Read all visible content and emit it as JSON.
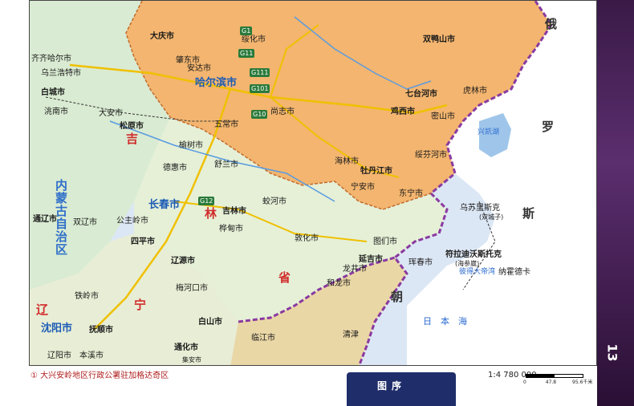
{
  "page_number": "13",
  "footnote": "① 大兴安岭地区行政公署驻加格达奇区",
  "tab_label": "图序",
  "scale": {
    "ratio": "1:4 780 000",
    "ticks": [
      "0",
      "47.8",
      "95.6千米"
    ]
  },
  "countries": {
    "russia_1": "俄",
    "russia_2": "罗",
    "russia_3": "斯"
  },
  "provinces": {
    "jilin_1": "吉",
    "jilin_2": "林",
    "jilin_3": "省",
    "liaoning_1": "辽",
    "liaoning_2": "宁",
    "inner_mongolia": "内蒙古自治区",
    "korea": "朝"
  },
  "waters": {
    "sea_of_japan": "日　本　海",
    "peter_bay": "彼得大帝湾",
    "khanka": "兴凯湖"
  },
  "cities": {
    "harbin": "哈尔滨市",
    "daqing": "大庆市",
    "qiqihar_area": "齐齐哈尔市",
    "jixi": "鸡西市",
    "qitaihe": "七台河市",
    "mudanjiang": "牡丹江市",
    "changchun": "长春市",
    "jilin": "吉林市",
    "siping": "四平市",
    "liaoyuan": "辽源市",
    "tieling": "铁岭市",
    "shenyang": "沈阳市",
    "fushun": "抚顺市",
    "tonghua": "通化市",
    "baishan": "白山市",
    "yanji": "延吉市",
    "tumen": "图们市",
    "songyuan": "松原市",
    "baicheng": "白城市",
    "tongliao": "通辽市",
    "ulanhot": "乌兰浩特市",
    "zhaodong": "肇东市",
    "suihua": "绥化市",
    "shuangyashan": "双鸭山市",
    "hunchun": "珲春市",
    "dunhua": "敦化市",
    "vladivostok": "符拉迪沃斯托克",
    "vladivostok_sub": "(海参崴)",
    "ussuriysk": "乌苏里斯克",
    "ussuriysk_sub": "(双城子)",
    "qingjin": "清津",
    "nakhodka": "纳霍德卡",
    "liaoyang": "辽阳市",
    "benxi": "本溪市",
    "mishan": "密山市",
    "hulin": "虎林市",
    "dongning": "东宁市",
    "suifenhe": "绥芬河市",
    "ningan": "宁安市",
    "hailin": "海林市",
    "shangzhi": "尚志市",
    "wuchang": "五常市",
    "shulan": "舒兰市",
    "jiaohe": "蛟河市",
    "huadian": "桦甸市",
    "meihekou": "梅河口市",
    "ji_an": "集安市",
    "linjiang": "临江市",
    "helong": "和龙市",
    "longjing": "龙井市",
    "yushu": "榆树市",
    "dehui": "德惠市",
    "gongzhuling": "公主岭市",
    "shuangliao": "双辽市",
    "taonan": "洮南市",
    "da_an": "大安市",
    "anda": "安达市"
  },
  "roads": [
    "G1",
    "G10",
    "G11",
    "G12",
    "G101",
    "G111"
  ]
}
